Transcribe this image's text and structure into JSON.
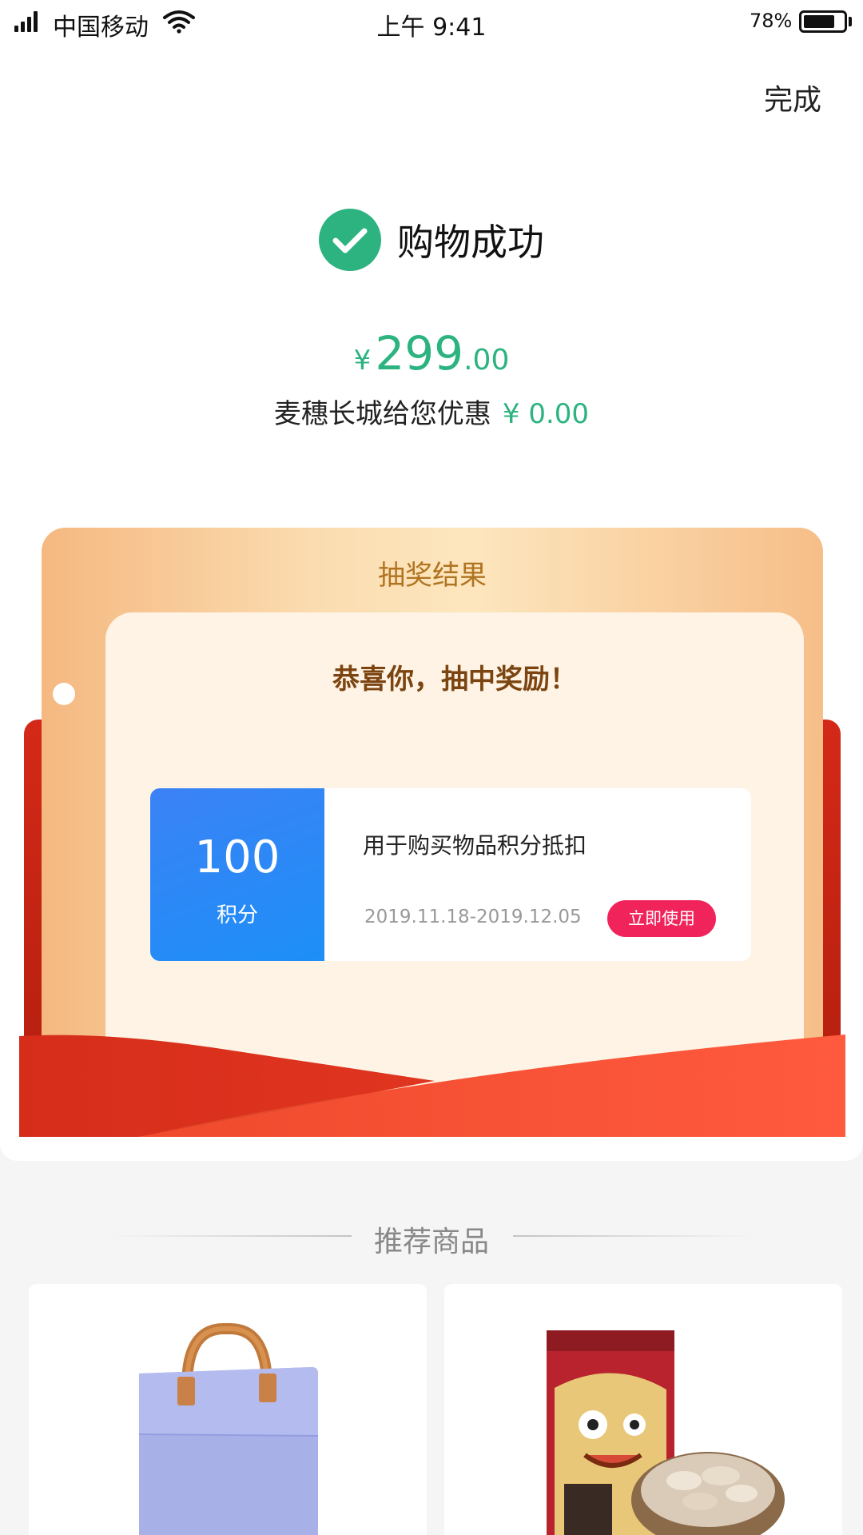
{
  "status_bar": {
    "carrier": "中国移动",
    "time": "上午 9:41",
    "battery": "78%"
  },
  "header": {
    "done_label": "完成"
  },
  "result": {
    "title": "购物成功",
    "currency": "¥",
    "amount_int": "299",
    "amount_dec": ".00",
    "discount_label": "麦穗长城给您优惠",
    "discount_amount": "¥ 0.00"
  },
  "prize": {
    "title": "抽奖结果",
    "congrats": "恭喜你，抽中奖励！",
    "coupon": {
      "points": "100",
      "unit": "积分",
      "description": "用于购买物品积分抵扣",
      "date_range": "2019.11.18-2019.12.05",
      "use_label": "立即使用"
    }
  },
  "recommend": {
    "title": "推荐商品",
    "products": [
      {
        "icon": "laptop-bag-image"
      },
      {
        "icon": "dried-food-package-image"
      }
    ]
  },
  "colors": {
    "accent_green": "#2db380",
    "coupon_blue": "#1d8ff7",
    "use_button": "#f0245a",
    "ribbon_red": "#e8321f"
  }
}
